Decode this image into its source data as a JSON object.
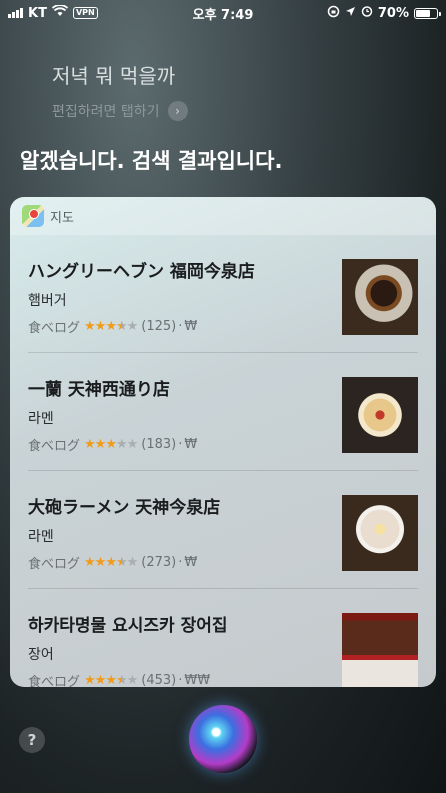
{
  "status_bar": {
    "carrier": "KT",
    "vpn": "VPN",
    "time": "오후 7:49",
    "battery_percent": "70%",
    "battery_level": 0.7
  },
  "siri": {
    "query": "저녁 뭐 먹을까",
    "edit_hint": "편집하려면 탭하기",
    "response": "알겠습니다. 검색 결과입니다."
  },
  "card": {
    "app_label": "지도",
    "app_icon": "maps-icon",
    "results": [
      {
        "name": "ハングリーヘブン 福岡今泉店",
        "category": "햄버거",
        "source": "食べログ",
        "rating": 3.5,
        "reviews": "(125)",
        "price": "₩",
        "thumb": "burger"
      },
      {
        "name": "一蘭 天神西通り店",
        "category": "라멘",
        "source": "食べログ",
        "rating": 3,
        "reviews": "(183)",
        "price": "₩",
        "thumb": "ramen"
      },
      {
        "name": "大砲ラーメン 天神今泉店",
        "category": "라멘",
        "source": "食べログ",
        "rating": 3.5,
        "reviews": "(273)",
        "price": "₩",
        "thumb": "ramen2"
      },
      {
        "name": "하카타명물 요시즈카 장어집",
        "category": "장어",
        "source": "食べログ",
        "rating": 3.5,
        "reviews": "(453)",
        "price": "₩₩",
        "thumb": "unagi"
      }
    ]
  },
  "help_label": "?",
  "colors": {
    "star_on": "#f19b1a",
    "star_off": "#a9aeb0"
  }
}
